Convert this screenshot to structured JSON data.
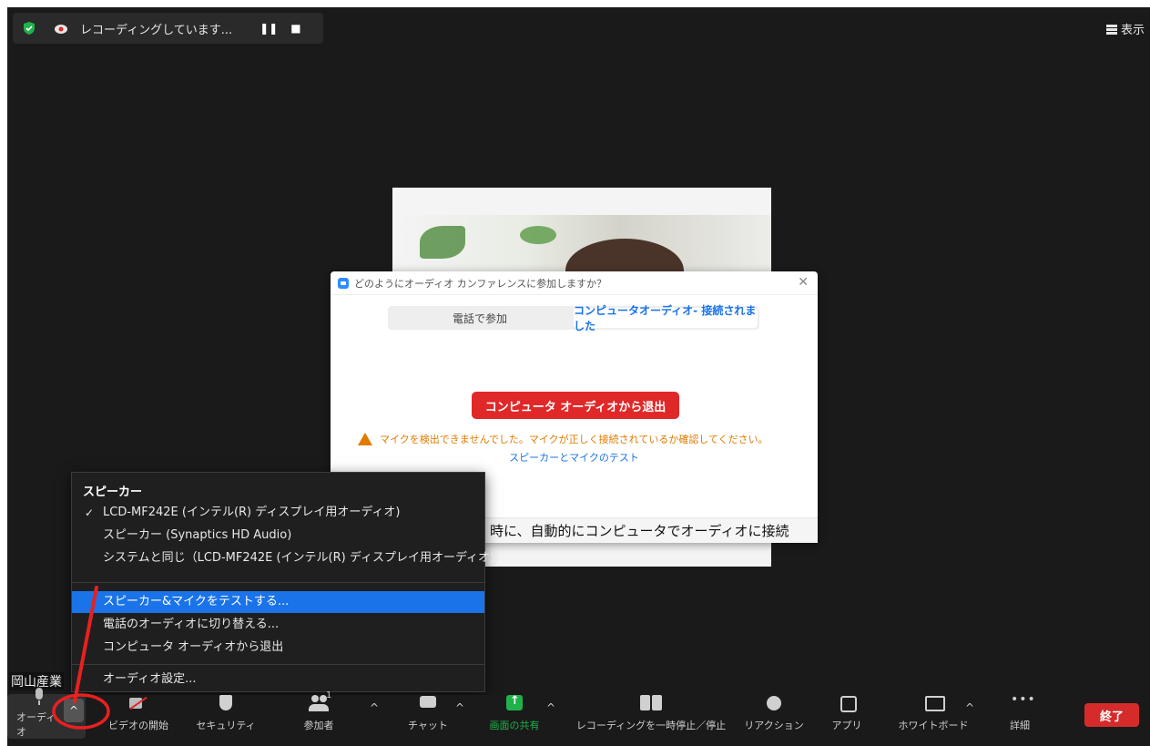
{
  "top_bar": {
    "recording_text": "レコーディングしています...",
    "pause_glyph": "❚❚",
    "stop_glyph": "■",
    "view_label": "表示",
    "view_icon": "grid-icon"
  },
  "audio_dialog": {
    "title": "どのようにオーディオ カンファレンスに参加しますか？",
    "close_glyph": "✕",
    "tabs": [
      {
        "label": "電話で参加",
        "active": false
      },
      {
        "label": "コンピュータオーディオ- 接続されました",
        "active": true
      }
    ],
    "leave_button": "コンピュータ オーディオから退出",
    "warning": "マイクを検出できませんでした。マイクが正しく接続されているか確認してください。",
    "test_link": "スピーカーとマイクのテスト",
    "auto_join_text": "時に、自動的にコンピュータでオーディオに接続"
  },
  "audio_menu": {
    "speaker_title": "スピーカー",
    "check_glyph": "✓",
    "speakers": [
      {
        "label": "LCD-MF242E (インテル(R) ディスプレイ用オーディオ)",
        "checked": true
      },
      {
        "label": "スピーカー (Synaptics HD Audio)",
        "checked": false
      },
      {
        "label": "システムと同じ（LCD-MF242E (インテル(R) ディスプレイ用オーディオ)）",
        "checked": false
      }
    ],
    "actions": [
      {
        "label": "スピーカー&マイクをテストする...",
        "selected": true
      },
      {
        "label": "電話のオーディオに切り替える...",
        "selected": false
      },
      {
        "label": "コンピュータ オーディオから退出",
        "selected": false
      }
    ],
    "settings": "オーディオ設定..."
  },
  "user_label": "岡山産業",
  "toolbar": {
    "caret_glyph": "^",
    "audio": "オーディオ",
    "video": "ビデオの開始",
    "security": "セキュリティ",
    "participants": "参加者",
    "participants_count": "1",
    "chat": "チャット",
    "share": "画面の共有",
    "record": "レコーディングを一時停止／停止",
    "reactions": "リアクション",
    "apps": "アプリ",
    "whiteboard": "ホワイトボード",
    "more": "詳細",
    "end": "終了"
  },
  "colors": {
    "accent_blue": "#1a73e8",
    "end_red": "#d62b2b",
    "share_green": "#21b14b",
    "warning_orange": "#e07b00",
    "annotation_red": "#e82020"
  }
}
